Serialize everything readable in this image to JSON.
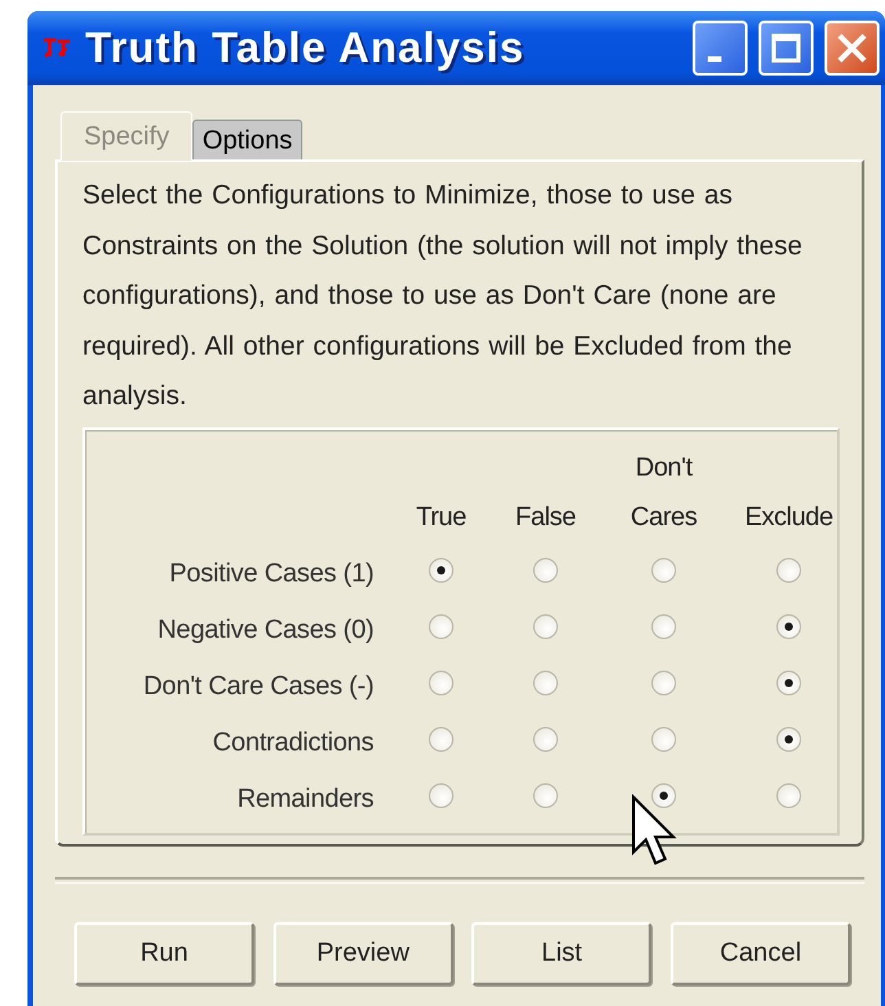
{
  "window": {
    "title": "Truth Table Analysis"
  },
  "tabs": [
    {
      "label": "Specify",
      "selected": true
    },
    {
      "label": "Options",
      "selected": false
    }
  ],
  "instructions": "Select the Configurations to Minimize, those to use as Constraints on the Solution (the solution will not imply these configurations), and those to use as Don't Care (none are required).  All other configurations will be Excluded from the analysis.",
  "grid": {
    "columns": [
      "True",
      "False",
      "Don't Cares",
      "Exclude"
    ],
    "rows": [
      {
        "label": "Positive Cases (1)",
        "options": [
          {
            "selected": true
          },
          {
            "selected": false
          },
          {
            "selected": false
          },
          {
            "selected": false
          }
        ]
      },
      {
        "label": "Negative Cases (0)",
        "options": [
          {
            "selected": false
          },
          {
            "selected": false
          },
          {
            "selected": false
          },
          {
            "selected": true
          }
        ]
      },
      {
        "label": "Don't Care Cases (-)",
        "options": [
          {
            "selected": false
          },
          {
            "selected": false
          },
          {
            "selected": false
          },
          {
            "selected": true
          }
        ]
      },
      {
        "label": "Contradictions",
        "options": [
          {
            "selected": false
          },
          {
            "selected": false
          },
          {
            "selected": false
          },
          {
            "selected": true
          }
        ]
      },
      {
        "label": "Remainders",
        "options": [
          {
            "selected": false
          },
          {
            "selected": false
          },
          {
            "selected": true
          },
          {
            "selected": false
          }
        ]
      }
    ]
  },
  "buttons": [
    "Run",
    "Preview",
    "List",
    "Cancel"
  ]
}
